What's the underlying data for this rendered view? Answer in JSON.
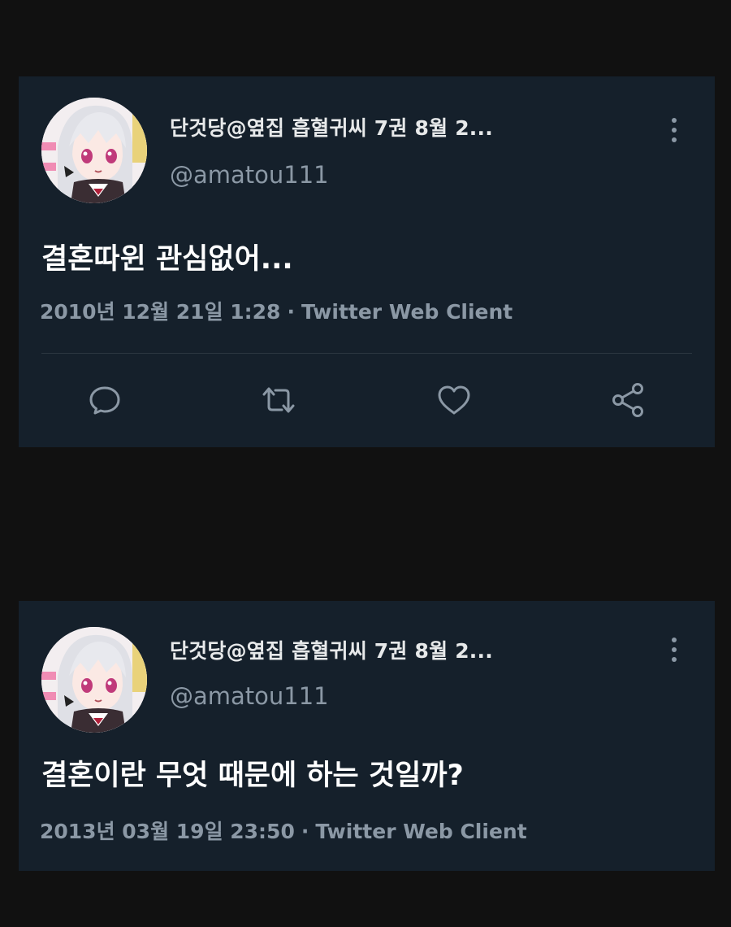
{
  "tweets": [
    {
      "display_name": "단것당@옆집 흡혈귀씨 7권 8월 2...",
      "handle": "@amatou111",
      "text": "결혼따윈 관심없어...",
      "datetime": "2010년 12월 21일 1:28",
      "separator": "·",
      "client": "Twitter Web Client",
      "actions": [
        "reply-icon",
        "retweet-icon",
        "like-icon",
        "share-icon"
      ]
    },
    {
      "display_name": "단것당@옆집 흡혈귀씨 7권 8월 2...",
      "handle": "@amatou111",
      "text": "결혼이란 무엇 때문에 하는 것일까?",
      "datetime": "2013년 03월 19일 23:50",
      "separator": "·",
      "client": "Twitter Web Client"
    }
  ],
  "colors": {
    "page_background": "#111111",
    "card_background": "#15202b",
    "secondary_text": "#8b98a5",
    "primary_text": "#ffffff"
  }
}
